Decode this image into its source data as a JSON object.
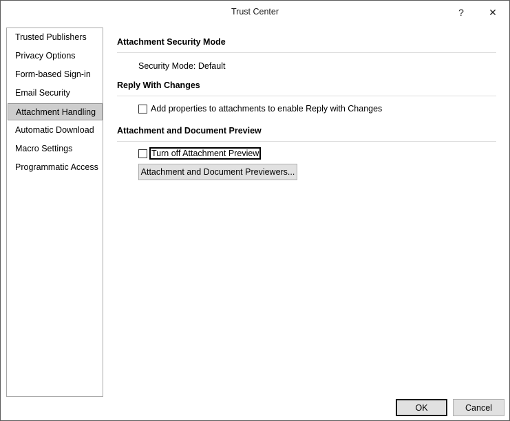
{
  "window": {
    "title": "Trust Center",
    "help_glyph": "?",
    "close_glyph": "✕"
  },
  "sidebar": {
    "items": [
      {
        "label": "Trusted Publishers",
        "selected": false
      },
      {
        "label": "Privacy Options",
        "selected": false
      },
      {
        "label": "Form-based Sign-in",
        "selected": false
      },
      {
        "label": "Email Security",
        "selected": false
      },
      {
        "label": "Attachment Handling",
        "selected": true
      },
      {
        "label": "Automatic Download",
        "selected": false
      },
      {
        "label": "Macro Settings",
        "selected": false
      },
      {
        "label": "Programmatic Access",
        "selected": false
      }
    ]
  },
  "main": {
    "security_mode": {
      "header": "Attachment Security Mode",
      "text": "Security Mode: Default"
    },
    "reply_with_changes": {
      "header": "Reply With Changes",
      "checkbox_label": "Add properties to attachments to enable Reply with Changes",
      "checked": false
    },
    "preview": {
      "header": "Attachment and Document Preview",
      "checkbox_label": "Turn off Attachment Preview",
      "checked": false,
      "previewers_button": "Attachment and Document Previewers..."
    }
  },
  "footer": {
    "ok_label": "OK",
    "cancel_label": "Cancel"
  }
}
